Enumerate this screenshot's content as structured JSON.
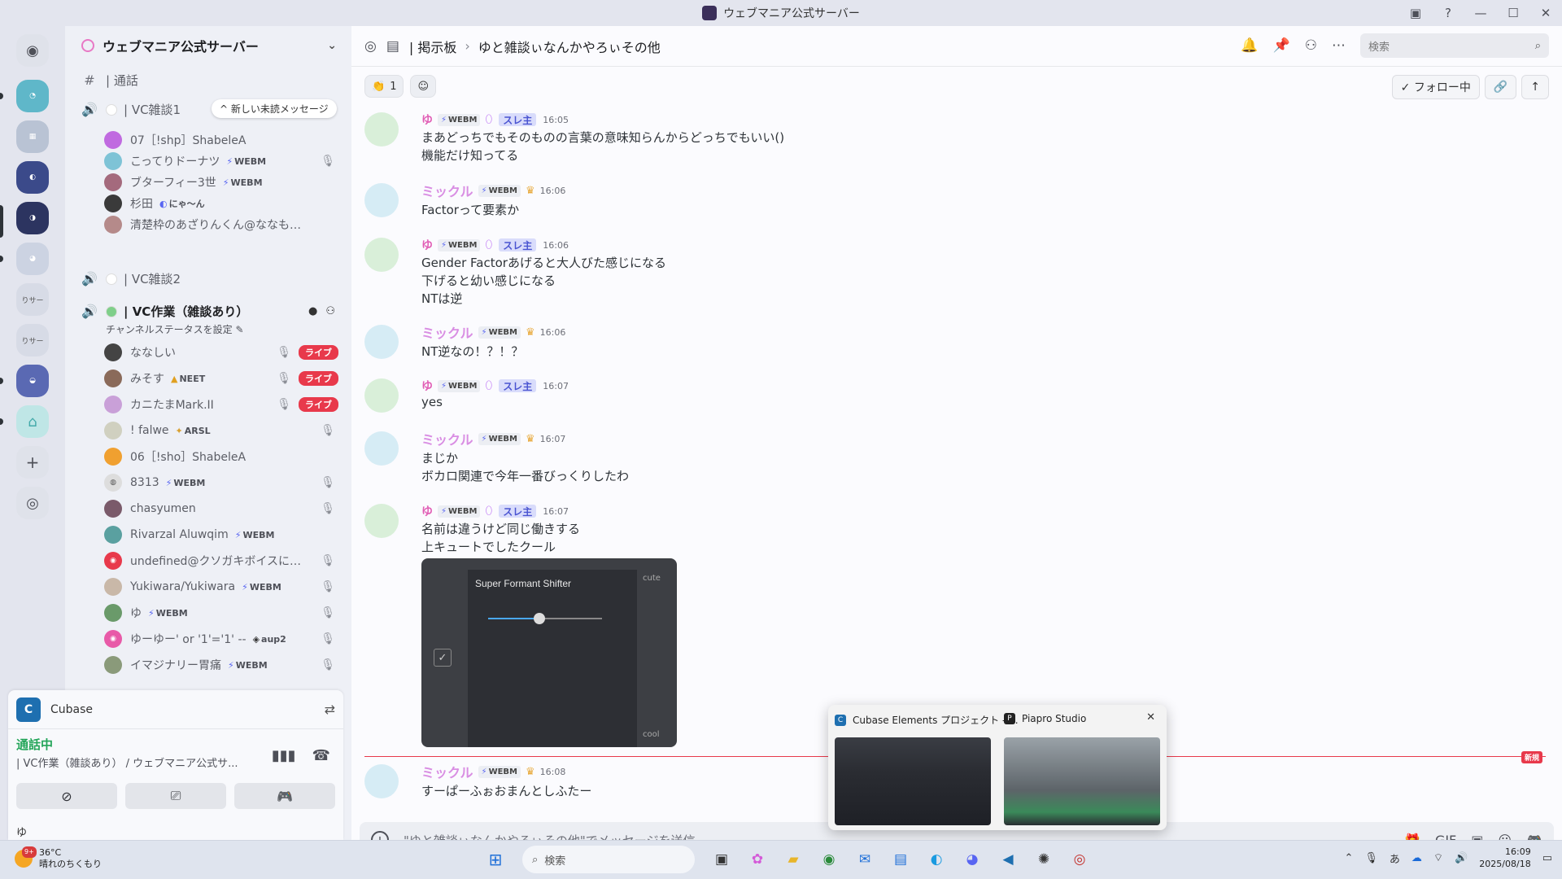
{
  "window": {
    "title": "ウェブマニア公式サーバー"
  },
  "server": {
    "name": "ウェブマニア公式サーバー"
  },
  "channels": {
    "unread_pill": "^ 新しい未読メッセージ",
    "partial_channel": "| 通話",
    "vc1": "| VC雑談1",
    "vc1_members": [
      {
        "name": "07［!shp］ShabeleA",
        "tag": ""
      },
      {
        "name": "こってりドーナツ",
        "tag": "WEBM"
      },
      {
        "name": "ブターフィー3世",
        "tag": "WEBM"
      },
      {
        "name": "杉田",
        "tag": "にゃ〜ん"
      },
      {
        "name": "清楚枠のあざりんくん@ななもり。...",
        "tag": ""
      }
    ],
    "vc2": "| VC雑談2",
    "vc3": "| VC作業（雑談あり）",
    "vc3_status": "チャンネルステータスを設定 ✎",
    "live_label": "ライブ",
    "vc3_members": [
      {
        "name": "ななしい",
        "tag": ""
      },
      {
        "name": "みそす",
        "tag": "NEET"
      },
      {
        "name": "カニたまMark.II",
        "tag": ""
      },
      {
        "name": "! falwe",
        "tag": "ARSL"
      },
      {
        "name": "06［!sho］ShabeleA",
        "tag": ""
      },
      {
        "name": "8313",
        "tag": "WEBM"
      },
      {
        "name": "chasyumen",
        "tag": ""
      },
      {
        "name": "Rivarzal Aluwqim",
        "tag": "WEBM"
      },
      {
        "name": "undefined@クソガキボイスになっ...",
        "tag": ""
      },
      {
        "name": "Yukiwara/Yukiwara",
        "tag": "WEBM"
      },
      {
        "name": "ゆ",
        "tag": "WEBM"
      },
      {
        "name": "ゆーゆー' or '1'='1' --",
        "tag": "aup2"
      },
      {
        "name": "イマジナリー胃痛",
        "tag": "WEBM"
      }
    ]
  },
  "voice_panel": {
    "app": "Cubase",
    "status": "通話中",
    "location": "| VC作業（雑談あり） / ウェブマニア公式サ...",
    "user": "ゆ"
  },
  "chat": {
    "header": {
      "forum": "| 掲示板",
      "sep": "›",
      "thread": "ゆと雑談ぃなんかやろぃその他",
      "search_placeholder": "検索"
    },
    "reaction": {
      "emoji": "👏",
      "count": "1"
    },
    "follow_label": "✓ フォロー中",
    "badge_webm": "WEBM",
    "op_label": "スレ主",
    "messages": [
      {
        "author": "ゆ",
        "time": "16:05",
        "lines": [
          "まあどっちでもそのものの言葉の意味知らんからどっちでもいい()",
          "機能だけ知ってる"
        ]
      },
      {
        "author": "ミックル",
        "time": "16:06",
        "lines": [
          "Factorって要素か"
        ]
      },
      {
        "author": "ゆ",
        "time": "16:06",
        "lines": [
          "Gender Factorあげると大人びた感じになる",
          "下げると幼い感じになる",
          "NTは逆"
        ]
      },
      {
        "author": "ミックル",
        "time": "16:06",
        "lines": [
          "NT逆なの！？！？"
        ]
      },
      {
        "author": "ゆ",
        "time": "16:07",
        "lines": [
          "yes"
        ]
      },
      {
        "author": "ミックル",
        "time": "16:07",
        "lines": [
          "まじか",
          "ボカロ関連で今年一番びっくりしたわ"
        ]
      },
      {
        "author": "ゆ",
        "time": "16:07",
        "lines": [
          "名前は違うけど同じ働きする",
          "上キュートでしたクール"
        ]
      },
      {
        "author": "ミックル",
        "time": "16:08",
        "lines": [
          "すーぱーふぉおまんとしふたー"
        ]
      }
    ],
    "attachment": {
      "title": "Super Formant Shifter",
      "top_label": "cute",
      "bottom_label": "cool",
      "slider": 0.45
    },
    "new_label": "新規",
    "composer_placeholder": "\"ゆと雑談ぃなんかやろぃその他\"でメッセージを送信"
  },
  "thumbnails": [
    {
      "title": "Cubase Elements プロジェクト - ..."
    },
    {
      "title": "Piapro Studio"
    }
  ],
  "taskbar": {
    "weather_temp": "36°C",
    "weather_desc": "晴れのちくもり",
    "weather_badge": "9+",
    "search": "検索",
    "time": "16:09",
    "date": "2025/08/18"
  },
  "colors": {
    "accent": "#5865f2",
    "live": "#e8394b",
    "yu_name": "#e15fb6",
    "miku_name": "#d98ee3",
    "in_call": "#23a559"
  }
}
